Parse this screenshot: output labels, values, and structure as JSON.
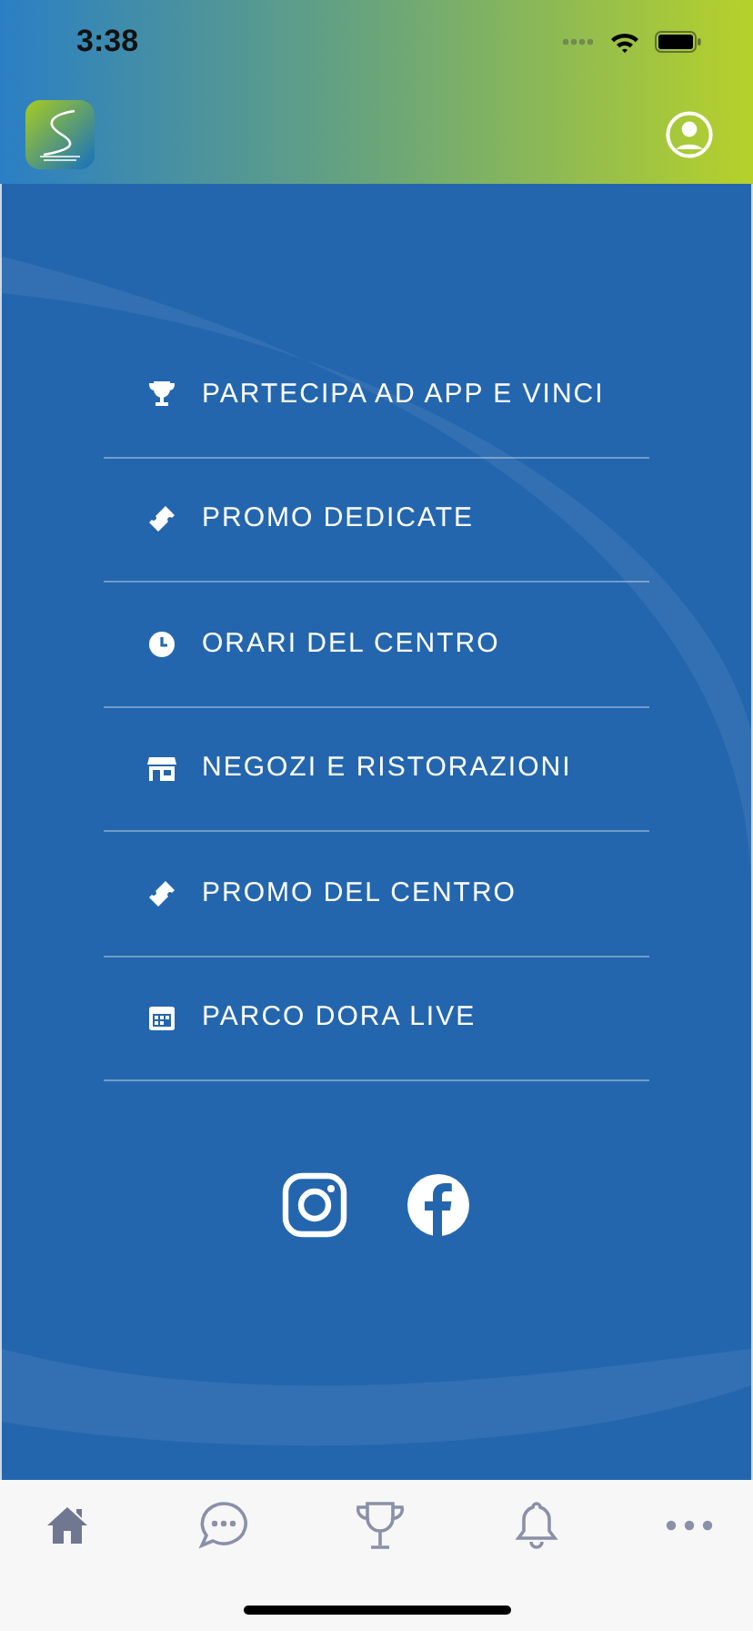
{
  "status_bar": {
    "time": "3:38"
  },
  "menu": [
    {
      "kind": "trophy",
      "label": "PARTECIPA AD APP E VINCI"
    },
    {
      "kind": "ticket",
      "label": "PROMO DEDICATE"
    },
    {
      "kind": "clock",
      "label": "ORARI DEL CENTRO"
    },
    {
      "kind": "store",
      "label": "NEGOZI E RISTORAZIONI"
    },
    {
      "kind": "ticket",
      "label": "PROMO DEL CENTRO"
    },
    {
      "kind": "calendar",
      "label": "PARCO DORA LIVE"
    }
  ],
  "social": [
    {
      "kind": "instagram"
    },
    {
      "kind": "facebook"
    }
  ],
  "tab_bar": [
    {
      "kind": "home",
      "selected": true
    },
    {
      "kind": "chat",
      "selected": false
    },
    {
      "kind": "trophy",
      "selected": false
    },
    {
      "kind": "bell",
      "selected": false
    },
    {
      "kind": "more",
      "selected": false
    }
  ]
}
